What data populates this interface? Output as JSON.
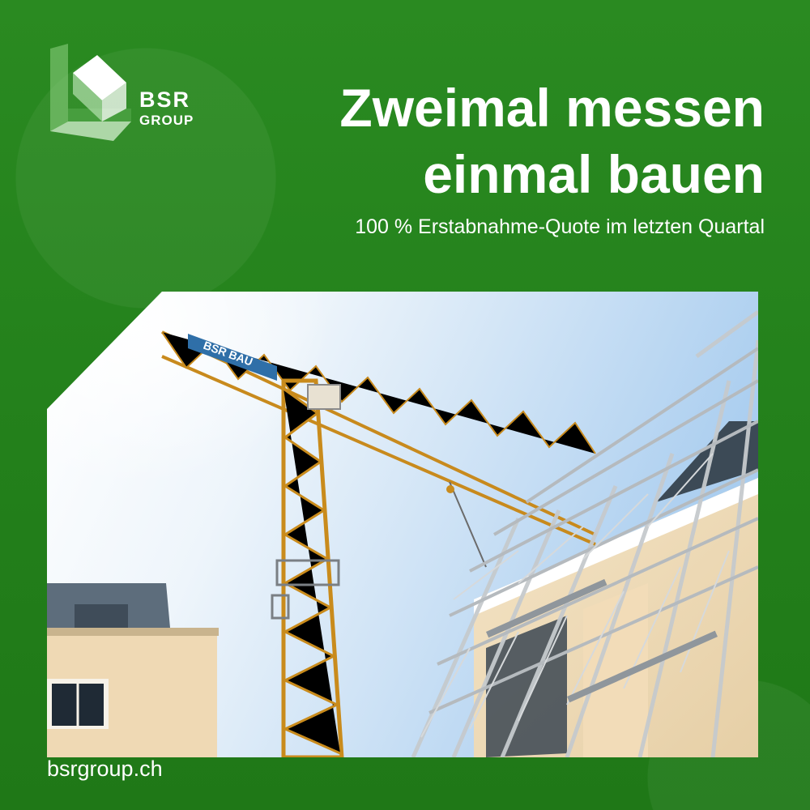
{
  "brand": {
    "name_line1": "BSR",
    "name_line2": "GROUP",
    "color": "#247f1c"
  },
  "headline": {
    "line1": "Zweimal messen",
    "line2": "einmal bauen"
  },
  "subline": "100 % Erstabnahme-Quote im letzten Quartal",
  "crane_sign": "BSR BAU",
  "footer": {
    "url": "bsrgroup.ch"
  }
}
